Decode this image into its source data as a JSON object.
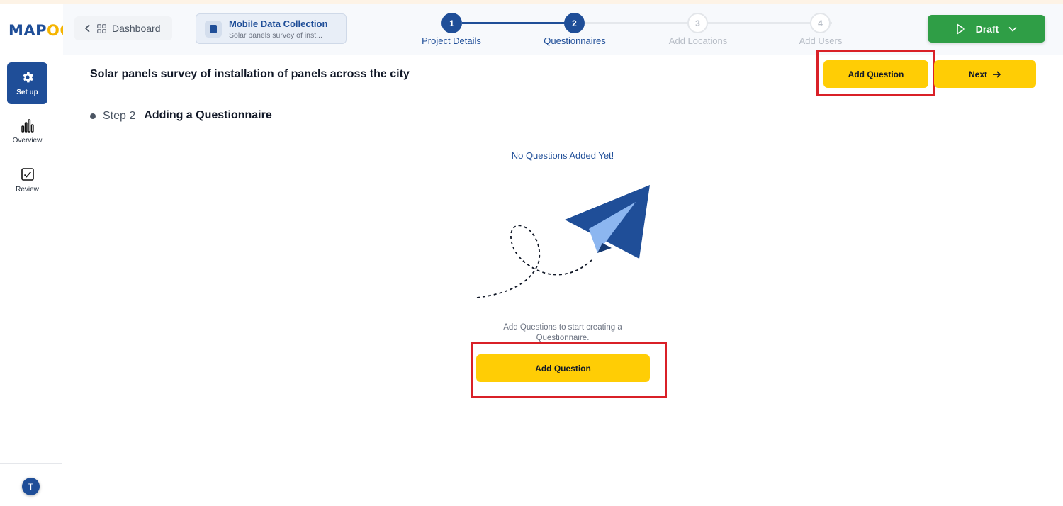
{
  "app": {
    "logo_prefix": "MAP",
    "logo_suffix": "OG"
  },
  "sidebar": {
    "items": [
      {
        "label": "Set up",
        "icon": "gear-icon",
        "active": true
      },
      {
        "label": "Overview",
        "icon": "bar-chart-icon",
        "active": false
      },
      {
        "label": "Review",
        "icon": "checkbox-icon",
        "active": false
      }
    ],
    "avatar_initial": "T"
  },
  "header": {
    "back_label": "Dashboard",
    "project": {
      "type": "Mobile Data Collection",
      "name": "Solar panels survey of inst..."
    },
    "steps": [
      {
        "num": "1",
        "label": "Project Details",
        "state": "done"
      },
      {
        "num": "2",
        "label": "Questionnaires",
        "state": "active"
      },
      {
        "num": "3",
        "label": "Add Locations",
        "state": "todo"
      },
      {
        "num": "4",
        "label": "Add Users",
        "state": "todo"
      }
    ],
    "status_button": "Draft"
  },
  "main": {
    "title": "Solar panels survey of installation of panels across the city",
    "add_question_top": "Add Question",
    "next_label": "Next",
    "step_number": "Step 2",
    "step_name": "Adding a Questionnaire",
    "empty_title": "No Questions Added Yet!",
    "empty_subtitle": "Add Questions to start creating a Questionnaire.",
    "add_question_center": "Add Question"
  },
  "colors": {
    "primary": "#1f4e98",
    "accent": "#ffcd05",
    "success": "#2f9e46",
    "highlight": "#d92027"
  }
}
